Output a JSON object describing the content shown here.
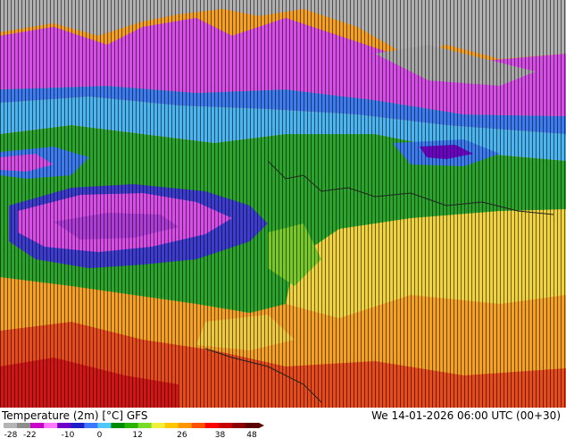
{
  "map": {
    "title": "Temperature (2m) [°C] GFS",
    "datetime": "We 14-01-2026 06:00 UTC (00+30)",
    "legend": {
      "ticks": [
        "-28",
        "-22",
        "-10",
        "0",
        "12",
        "26",
        "38",
        "48"
      ],
      "colors": [
        "#b4b4b4",
        "#8c8c8c",
        "#c800c8",
        "#ff78ff",
        "#6e00c8",
        "#1e1ec8",
        "#3c78ff",
        "#50c8ff",
        "#008c00",
        "#28b400",
        "#78dc28",
        "#f0f03c",
        "#ffc800",
        "#ff9600",
        "#ff5000",
        "#ff0000",
        "#c80000",
        "#8c0000",
        "#5a0000"
      ]
    },
    "colors": {
      "cold_grey": "#b0b0b0",
      "magenta": "#d84ce8",
      "blue": "#3c7cf0",
      "cyan": "#50c8ff",
      "green": "#2aa42a",
      "yellow": "#f0d23c",
      "orange": "#f5a020",
      "red": "#e82020"
    }
  }
}
